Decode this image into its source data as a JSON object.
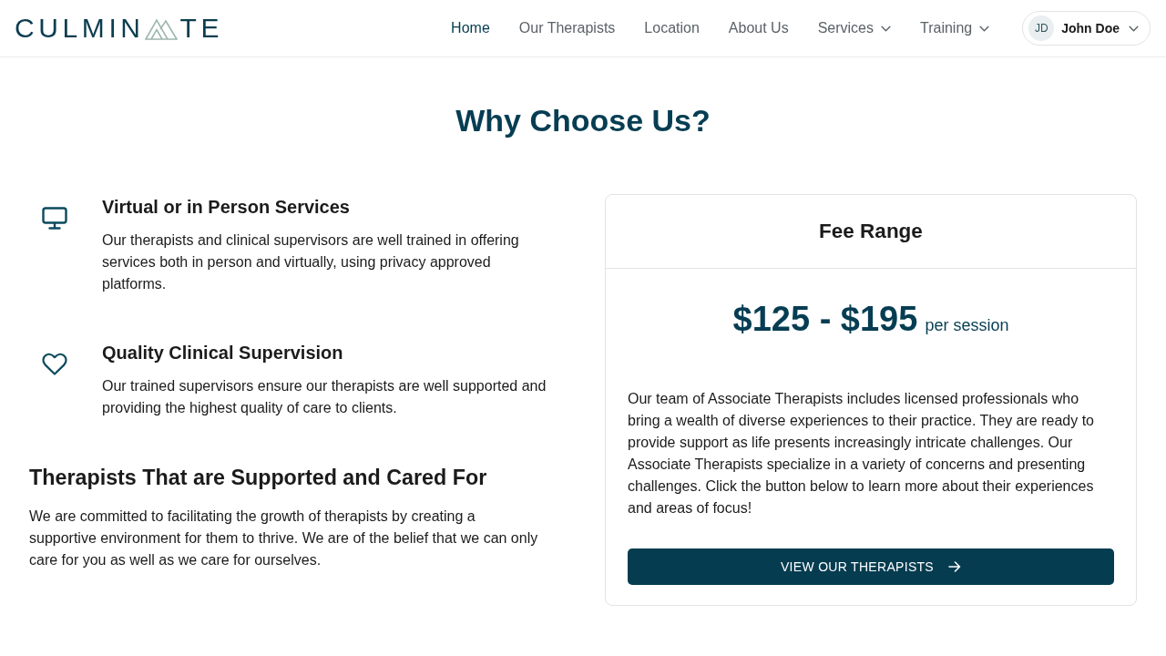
{
  "header": {
    "logo": {
      "text_start": "CULMIN",
      "text_end": "TE"
    },
    "nav": [
      {
        "label": "Home",
        "selected": true,
        "has_menu": false
      },
      {
        "label": "Our Therapists",
        "selected": false,
        "has_menu": false
      },
      {
        "label": "Location",
        "selected": false,
        "has_menu": false
      },
      {
        "label": "About Us",
        "selected": false,
        "has_menu": false
      },
      {
        "label": "Services",
        "selected": false,
        "has_menu": true
      },
      {
        "label": "Training",
        "selected": false,
        "has_menu": true
      }
    ],
    "user": {
      "initials": "JD",
      "name": "John Doe"
    }
  },
  "title": "Why Choose Us?",
  "features": [
    {
      "kind": "monitor",
      "title": "Virtual or in Person Services",
      "text": "Our therapists and clinical supervisors are well trained in offering services both in person and virtually, using privacy approved platforms."
    },
    {
      "kind": "heart",
      "title": "Quality Clinical Supervision",
      "text": "Our trained supervisors ensure our therapists are well supported and providing the highest quality of care to clients."
    }
  ],
  "support": {
    "heading": "Therapists That are Supported and Cared For",
    "text": "We are committed to facilitating the growth of therapists by creating a supportive environment for them to thrive. We are of the belief that we can only care for you as well as we care for ourselves."
  },
  "fee_card": {
    "title": "Fee Range",
    "price": "$125 - $195",
    "unit": "per session",
    "text": "Our team of Associate Therapists includes licensed professionals who bring a wealth of diverse experiences to their practice. They are ready to provide support as life presents increasingly intricate challenges. Our Associate Therapists specialize in a variety of concerns and presenting challenges. Click the button below to learn more about their experiences and areas of focus!",
    "button": "VIEW OUR THERAPISTS"
  }
}
